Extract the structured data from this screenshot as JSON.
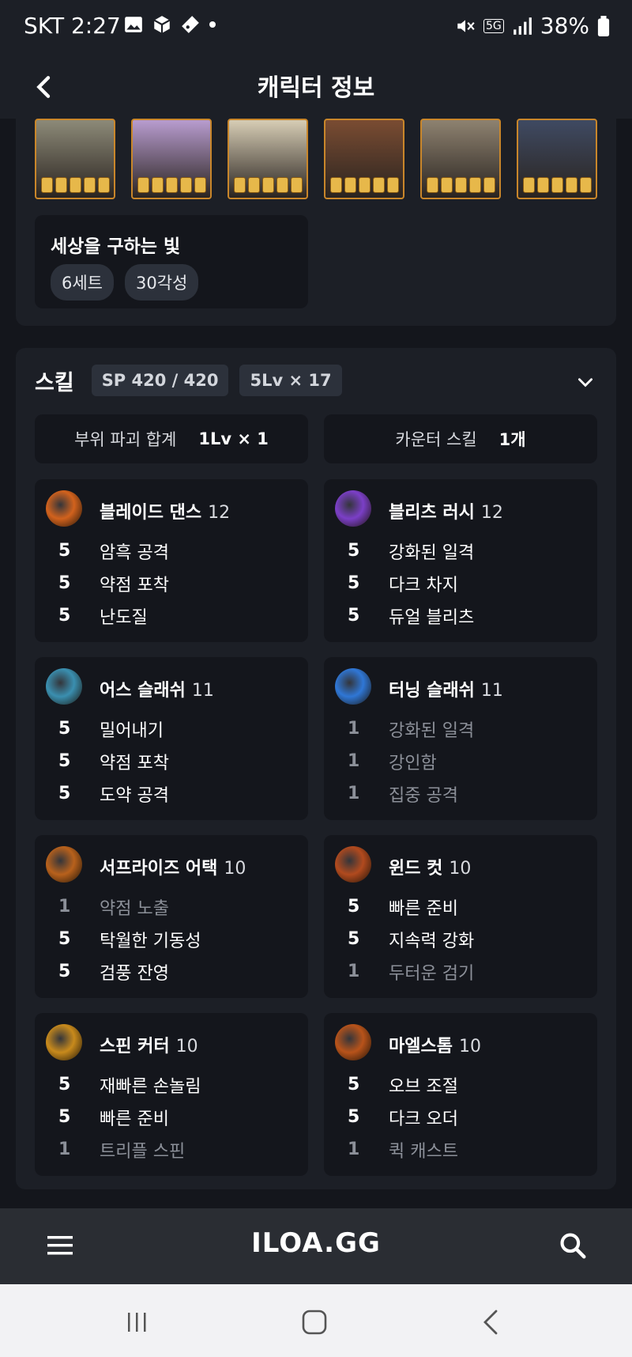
{
  "status_bar": {
    "carrier_time": "SKT 2:27",
    "network": "5G",
    "battery": "38%"
  },
  "app_bar": {
    "title": "캐릭터 정보"
  },
  "card_set": {
    "portraits": [
      {
        "stars": 5,
        "palette": "#8d8a78"
      },
      {
        "stars": 5,
        "palette": "#b89ccf"
      },
      {
        "stars": 5,
        "palette": "#d7cdb5"
      },
      {
        "stars": 5,
        "palette": "#7a4c32"
      },
      {
        "stars": 5,
        "palette": "#8e8270"
      },
      {
        "stars": 5,
        "palette": "#3f4a62"
      }
    ],
    "set_name": "세상을 구하는 빛",
    "chips": [
      "6세트",
      "30각성"
    ]
  },
  "skills": {
    "header": "스킬",
    "sp": "SP 420 / 420",
    "levels": "5Lv × 17",
    "summary": [
      {
        "label": "부위 파괴 합계",
        "value": "1Lv × 1"
      },
      {
        "label": "카운터 스킬",
        "value": "1개"
      }
    ],
    "items": [
      {
        "name": "블레이드 댄스",
        "level": "12",
        "icon_color": "#d2621d",
        "tripods": [
          {
            "lv": "5",
            "name": "암흑 공격"
          },
          {
            "lv": "5",
            "name": "약점 포착"
          },
          {
            "lv": "5",
            "name": "난도질"
          }
        ]
      },
      {
        "name": "블리츠 러시",
        "level": "12",
        "icon_color": "#7b3fc7",
        "tripods": [
          {
            "lv": "5",
            "name": "강화된 일격"
          },
          {
            "lv": "5",
            "name": "다크 차지"
          },
          {
            "lv": "5",
            "name": "듀얼 블리츠"
          }
        ]
      },
      {
        "name": "어스 슬래쉬",
        "level": "11",
        "icon_color": "#3a8fb0",
        "tripods": [
          {
            "lv": "5",
            "name": "밀어내기"
          },
          {
            "lv": "5",
            "name": "약점 포착"
          },
          {
            "lv": "5",
            "name": "도약 공격"
          }
        ]
      },
      {
        "name": "터닝 슬래쉬",
        "level": "11",
        "icon_color": "#2f77d6",
        "tripods": [
          {
            "lv": "1",
            "name": "강화된 일격"
          },
          {
            "lv": "1",
            "name": "강인함"
          },
          {
            "lv": "1",
            "name": "집중 공격"
          }
        ]
      },
      {
        "name": "서프라이즈 어택",
        "level": "10",
        "icon_color": "#b8611c",
        "tripods": [
          {
            "lv": "1",
            "name": "약점 노출"
          },
          {
            "lv": "5",
            "name": "탁월한 기동성"
          },
          {
            "lv": "5",
            "name": "검풍 잔영"
          }
        ]
      },
      {
        "name": "윈드 컷",
        "level": "10",
        "icon_color": "#b14a1e",
        "tripods": [
          {
            "lv": "5",
            "name": "빠른 준비"
          },
          {
            "lv": "5",
            "name": "지속력 강화"
          },
          {
            "lv": "1",
            "name": "두터운 검기"
          }
        ]
      },
      {
        "name": "스핀 커터",
        "level": "10",
        "icon_color": "#c88a1c",
        "tripods": [
          {
            "lv": "5",
            "name": "재빠른 손놀림"
          },
          {
            "lv": "5",
            "name": "빠른 준비"
          },
          {
            "lv": "1",
            "name": "트리플 스핀"
          }
        ]
      },
      {
        "name": "마엘스톰",
        "level": "10",
        "icon_color": "#b8531a",
        "tripods": [
          {
            "lv": "5",
            "name": "오브 조절"
          },
          {
            "lv": "5",
            "name": "다크 오더"
          },
          {
            "lv": "1",
            "name": "퀵 캐스트"
          }
        ]
      }
    ]
  },
  "bottom_nav": {
    "logo": "ILOA.GG"
  }
}
